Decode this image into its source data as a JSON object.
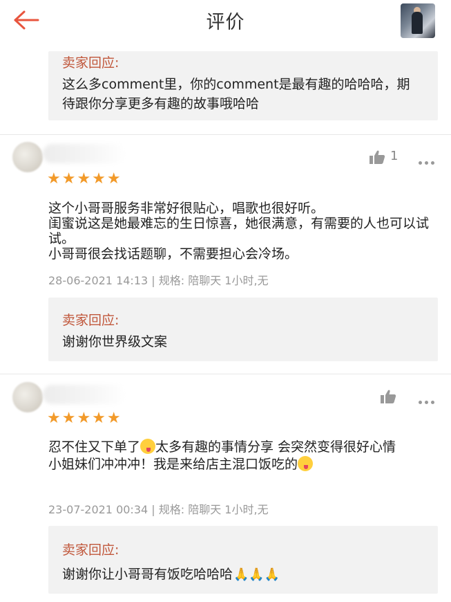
{
  "header": {
    "title": "评价"
  },
  "top_reply": {
    "label": "卖家回应:",
    "text": "这么多comment里，你的comment是最有趣的哈哈哈，期待跟你分享更多有趣的故事哦哈哈"
  },
  "reviews": [
    {
      "stars": "★★★★★",
      "like_count": "1",
      "lines": [
        "这个小哥哥服务非常好很贴心，唱歌也很好听。",
        "闺蜜说这是她最难忘的生日惊喜，她很满意，有需要的人也可以试试。",
        "小哥哥很会找话题聊，不需要担心会冷场。"
      ],
      "meta": "28-06-2021 14:13 | 规格: 陪聊天 1小时,无",
      "reply_label": "卖家回应:",
      "reply_text": "谢谢你世界级文案"
    },
    {
      "stars": "★★★★★",
      "like_count": "",
      "line1a": "忍不住又下单了",
      "line1b": "太多有趣的事情分享 会突然变得很好心情",
      "line2": "小姐妹们冲冲冲！我是来给店主混口饭吃的",
      "meta": "23-07-2021 00:34 | 规格: 陪聊天 1小时,无",
      "reply_label": "卖家回应:",
      "reply_text": "谢谢你让小哥哥有饭吃哈哈哈"
    }
  ],
  "icons": {
    "back": "arrow-left",
    "like": "thumbs-up",
    "more": "ellipsis",
    "emoji": "silly-face",
    "pray": "folded-hands"
  },
  "colors": {
    "accent": "#e8553e",
    "reply_label": "#c0563a",
    "star": "#f29a2a"
  }
}
